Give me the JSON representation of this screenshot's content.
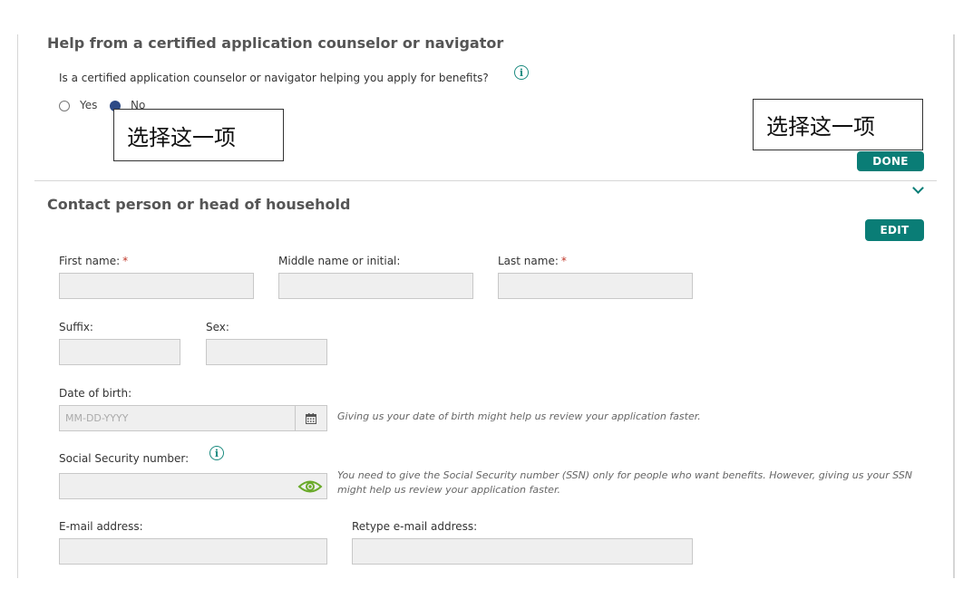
{
  "counselor_section": {
    "title": "Help from a certified application counselor or navigator",
    "question": "Is a certified application counselor or navigator helping you apply for benefits?",
    "options": [
      {
        "label": "Yes",
        "selected": false
      },
      {
        "label": "No",
        "selected": true
      }
    ],
    "done_label": "DONE"
  },
  "annotations": [
    "选择这一项",
    "选择这一项"
  ],
  "contact_section": {
    "title": "Contact person or head of household",
    "edit_label": "EDIT",
    "fields": {
      "first_name": {
        "label": "First name:",
        "required": "*"
      },
      "middle_name": {
        "label": "Middle name or initial:"
      },
      "last_name": {
        "label": "Last name:",
        "required": "*"
      },
      "suffix": {
        "label": "Suffix:"
      },
      "sex": {
        "label": "Sex:"
      },
      "dob": {
        "label": "Date of birth:",
        "placeholder": "MM-DD-YYYY",
        "help": "Giving us your date of birth might help us review your application faster."
      },
      "ssn": {
        "label": "Social Security number:",
        "help": "You need to give the Social Security number (SSN) only for people who want benefits. However, giving us your SSN might help us review your application faster."
      },
      "email": {
        "label": "E-mail address:"
      },
      "retype_email": {
        "label": "Retype e-mail address:"
      }
    }
  },
  "colors": {
    "accent": "#0a7d76",
    "radio_selected": "#2e4a86",
    "required": "#c0392b",
    "eye_icon": "#6aaa2a"
  },
  "icons": [
    "info-icon",
    "calendar-icon",
    "eye-icon",
    "chevron-down-icon"
  ]
}
